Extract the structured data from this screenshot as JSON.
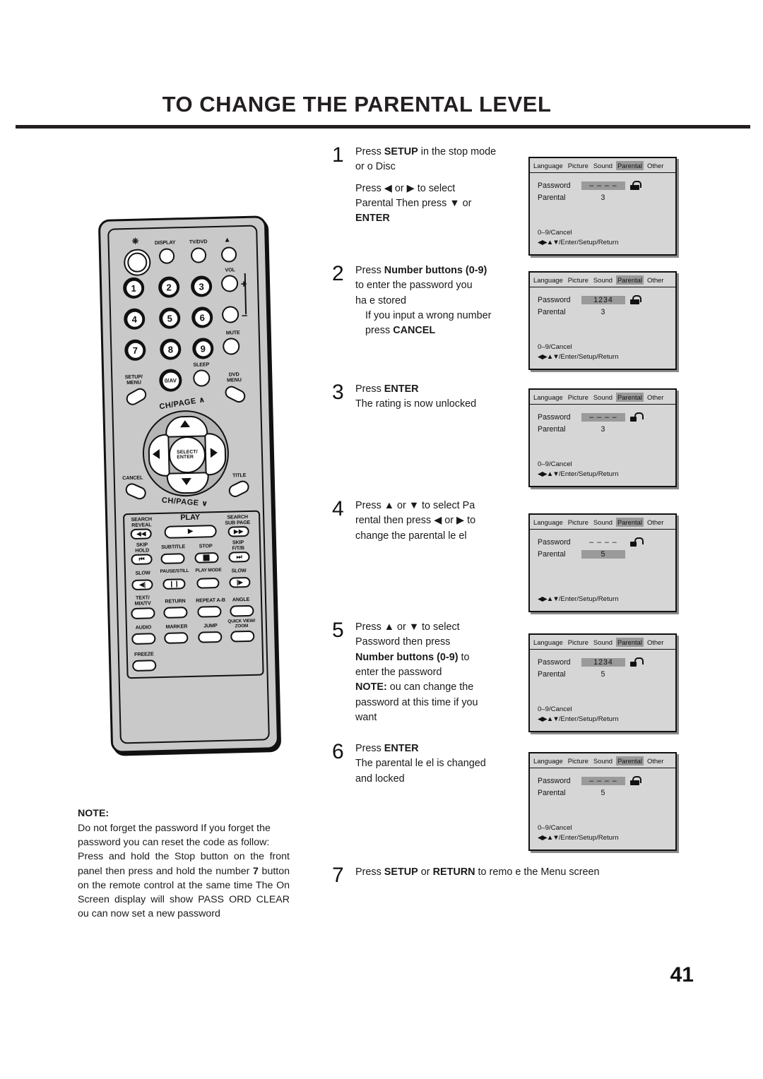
{
  "document": {
    "title": "TO CHANGE THE PARENTAL LEVEL",
    "page_number": "41"
  },
  "steps": [
    {
      "number": "1",
      "lines": [
        {
          "text": "Press SETUP in the stop mode",
          "bold_parts": [
            "SETUP"
          ]
        },
        {
          "text": "or  o Disc"
        },
        {
          "text": "Press ◀ or ▶ to select"
        },
        {
          "text": " Parental  Then press ▼ or",
          "indent": true
        },
        {
          "text": "ENTER",
          "bold": true
        }
      ]
    },
    {
      "number": "2",
      "lines": [
        {
          "text": "Press Number buttons  (0-9)"
        },
        {
          "text": "to enter the password you"
        },
        {
          "text": "ha e stored"
        },
        {
          "text": "If you input a wrong number",
          "indent": true
        },
        {
          "text": "press CANCEL",
          "indent": true
        }
      ]
    },
    {
      "number": "3",
      "lines": [
        {
          "text": "Press ENTER"
        },
        {
          "text": "The rating is now unlocked"
        }
      ]
    },
    {
      "number": "4",
      "lines": [
        {
          "text": "Press ▲ or ▼ to select  Pa"
        },
        {
          "text": "rental  then press ◀ or ▶ to"
        },
        {
          "text": "change the parental le el"
        }
      ]
    },
    {
      "number": "5",
      "lines": [
        {
          "text": "Press ▲ or ▼ to select"
        },
        {
          "text": " Password  then press"
        },
        {
          "text": "Number buttons (0-9) to"
        },
        {
          "text": "enter the password"
        },
        {
          "text": "NOTE:  ou can change the"
        },
        {
          "text": "password at this time if you"
        },
        {
          "text": "want"
        }
      ]
    },
    {
      "number": "6",
      "lines": [
        {
          "text": "Press ENTER"
        },
        {
          "text": "The parental le el is changed"
        },
        {
          "text": "and locked"
        }
      ]
    }
  ],
  "step1": {
    "num": "1",
    "l1_a": "Press ",
    "l1_b": "SETUP",
    "l1_c": " in the stop mode",
    "l2": "or  o Disc",
    "l3": "Press ◀ or ▶ to select",
    "l4": " Parental  Then press ▼ or",
    "l5": "ENTER"
  },
  "step2": {
    "num": "2",
    "l1_a": "Press ",
    "l1_b": "Number buttons",
    "l1_c": "  (0-9)",
    "l2": "to enter the password you",
    "l3": "ha e stored",
    "l4": "If you input a wrong number",
    "l5_a": "press ",
    "l5_b": "CANCEL"
  },
  "step3": {
    "num": "3",
    "l1_a": "Press ",
    "l1_b": "ENTER",
    "l2": "The rating is now unlocked"
  },
  "step4": {
    "num": "4",
    "l1": "Press ▲ or ▼ to select  Pa",
    "l2": "rental  then press ◀ or ▶ to",
    "l3": "change the parental le el"
  },
  "step5": {
    "num": "5",
    "l1": "Press ▲ or ▼ to select",
    "l2": " Password  then press",
    "l3_a": "Number buttons (0-9)",
    "l3_b": " to",
    "l4": "enter the password",
    "l5_a": "NOTE:",
    "l5_b": "  ou can change the",
    "l6": "password at this time if you",
    "l7": "want"
  },
  "step6": {
    "num": "6",
    "l1_a": "Press ",
    "l1_b": "ENTER",
    "l2": "The parental le el is changed",
    "l3": "and locked"
  },
  "step7": {
    "num": "7",
    "a": "Press ",
    "b": "SETUP",
    "c": " or ",
    "d": "RETURN",
    "e": " to remo e the Menu screen"
  },
  "osd": {
    "tabs": [
      "Language",
      "Picture",
      "Sound",
      "Parental",
      "Other"
    ],
    "active_tab": "Parental",
    "key_password": "Password",
    "key_parental": "Parental",
    "foot_line1": "0–9/Cancel",
    "foot_line2_arrows": "◀▶▲▼",
    "foot_line2_text": "/Enter/Setup/Return",
    "screens": [
      {
        "id": "osd-1",
        "password": "– – – –",
        "parental": "3",
        "password_highlighted": true,
        "parental_highlighted": false,
        "lock": "closed",
        "show_cancel_line": true
      },
      {
        "id": "osd-2",
        "password": "1234",
        "parental": "3",
        "password_highlighted": true,
        "parental_highlighted": false,
        "lock": "closed",
        "show_cancel_line": true
      },
      {
        "id": "osd-3",
        "password": "– – – –",
        "parental": "3",
        "password_highlighted": true,
        "parental_highlighted": false,
        "lock": "open",
        "show_cancel_line": true
      },
      {
        "id": "osd-4",
        "password": "– – – –",
        "parental": "5",
        "password_highlighted": false,
        "parental_highlighted": true,
        "lock": "open",
        "show_cancel_line": false
      },
      {
        "id": "osd-5",
        "password": "1234",
        "parental": "5",
        "password_highlighted": true,
        "parental_highlighted": false,
        "lock": "open",
        "show_cancel_line": true
      },
      {
        "id": "osd-6",
        "password": "– – – –",
        "parental": "5",
        "password_highlighted": true,
        "parental_highlighted": false,
        "lock": "closed",
        "show_cancel_line": true
      }
    ]
  },
  "note": {
    "title": "NOTE:",
    "p1": "Do not forget the password  If you forget the password  you can reset the code as follow:",
    "p2_a": "Press and hold the Stop button on the front panel  then press and hold the number ",
    "p2_b": "7",
    "p2_c": " button on the remote control at the same time  The On Screen display will show  PASS ORD CLEAR    ou can now set a new password"
  },
  "remote": {
    "labels": {
      "display": "DISPLAY",
      "tv_dvd": "TV/DVD",
      "eject": "▲",
      "vol": "VOL",
      "vol_plus": "+",
      "vol_minus": "–",
      "mute": "MUTE",
      "sleep": "SLEEP",
      "setup_menu": "SETUP/\nMENU",
      "dvd_menu": "DVD\nMENU",
      "zero_av": "0/AV",
      "ch_page_up": "CH/PAGE",
      "ch_page_down": "CH/PAGE",
      "select_enter": "SELECT/\nENTER",
      "cancel": "CANCEL",
      "title": "TITLE",
      "search_reveal": "SEARCH\nREVEAL",
      "play": "PLAY",
      "search_sub_page": "SEARCH\nSUB PAGE",
      "skip_hold": "SKIP\nHOLD",
      "subtitle": "SUBTITLE",
      "stop": "STOP",
      "skip_ftb": "SKIP\nF/T/B",
      "slow_left": "SLOW",
      "pause_still": "PAUSE/STILL",
      "play_mode": "PLAY MODE",
      "slow_right": "SLOW",
      "text_mix_tv": "TEXT/\nMIX/TV",
      "return": "RETURN",
      "repeat_ab": "REPEAT A-B",
      "angle": "ANGLE",
      "audio": "AUDIO",
      "marker": "MARKER",
      "jump": "JUMP",
      "quick_view_zoom": "QUICK VIEW/\nZOOM",
      "freeze": "FREEZE"
    },
    "numbers": [
      "1",
      "2",
      "3",
      "4",
      "5",
      "6",
      "7",
      "8",
      "9"
    ]
  }
}
